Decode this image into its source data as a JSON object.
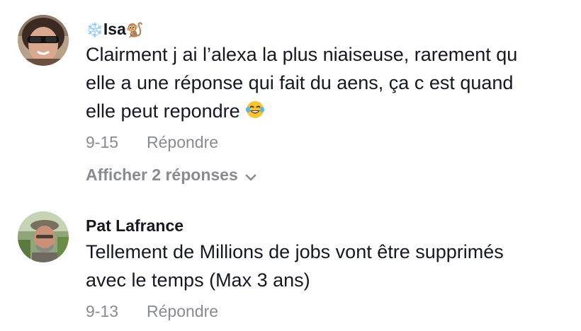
{
  "comments": [
    {
      "author_prefix_icon": "snowflake-icon",
      "author_prefix": "❄️",
      "author": "Isa",
      "author_suffix_icon": "monkey-icon",
      "author_suffix": "🐒",
      "lines": [
        "Clairment j ai l’alexa la plus niaiseuse, rarement qu",
        "elle a une réponse qui fait du aens, ça c est quand",
        "elle peut repondre"
      ],
      "text_emoji_icon": "tears-of-joy-icon",
      "date": "9-15",
      "reply_label": "Répondre",
      "view_replies_label": "Afficher 2 réponses"
    },
    {
      "author": "Pat Lafrance",
      "lines": [
        "Tellement de Millions de jobs vont être supprimés",
        "avec le temps (Max 3 ans)"
      ],
      "date": "9-13",
      "reply_label": "Répondre"
    }
  ],
  "colors": {
    "text": "#161823",
    "muted": "#8a8b91",
    "background": "#ffffff"
  }
}
